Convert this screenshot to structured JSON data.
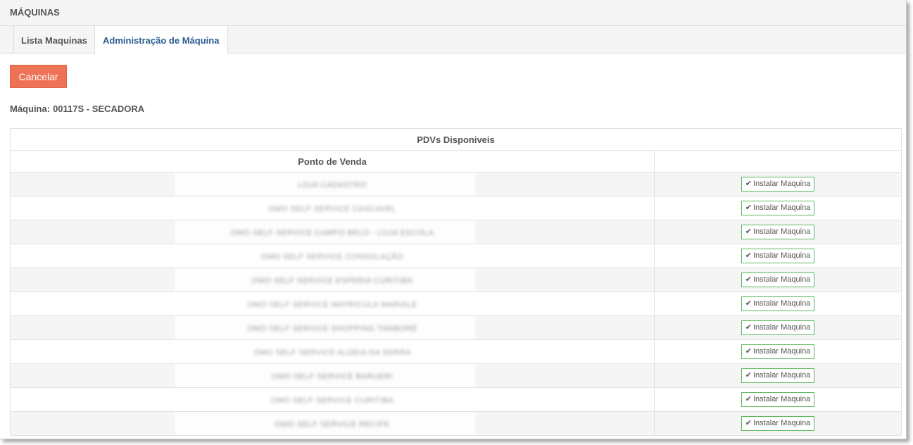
{
  "header": {
    "title": "MÁQUINAS"
  },
  "tabs": [
    {
      "label": "Lista Maquinas"
    },
    {
      "label": "Administração de Máquina"
    }
  ],
  "actions": {
    "cancel_label": "Cancelar"
  },
  "machine": {
    "label": "Máquina:",
    "value": "00117S - SECADORA"
  },
  "table": {
    "caption": "PDVs Disponiveis",
    "columns": [
      "Ponto de Venda",
      ""
    ],
    "install_label": "Instalar Maquina",
    "rows": [
      {
        "name": "LOJA CADASTRO"
      },
      {
        "name": "OMO SELF SERVICE CASCAVEL"
      },
      {
        "name": "OMO SELF SERVICE CAMPO BELO - LOJA ESCOLA"
      },
      {
        "name": "OMO SELF SERVICE CONSOLAÇÃO"
      },
      {
        "name": "OMO SELF SERVICE ESPERIA CURITIBA"
      },
      {
        "name": "OMO SELF SERVICE MATRICULA MARIALE"
      },
      {
        "name": "OMO SELF SERVICE SHOPPING TAMBORÉ"
      },
      {
        "name": "OMO SELF SERVICE ALDEIA DA SERRA"
      },
      {
        "name": "OMO SELF SERVICE BARUERI"
      },
      {
        "name": "OMO SELF SERVICE CURITIBA"
      },
      {
        "name": "OMO SELF SERVICE RECIFE"
      }
    ]
  },
  "colors": {
    "accent": "#ee7356",
    "active_tab": "#2a5c91",
    "install_border": "#5cb85c"
  },
  "icons": {
    "install": "check-icon"
  }
}
